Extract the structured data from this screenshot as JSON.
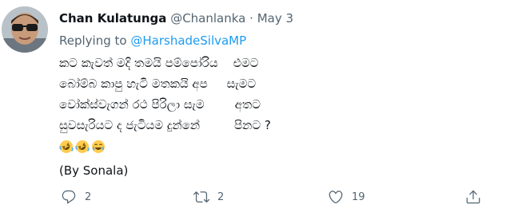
{
  "tweet": {
    "author_name": "Chan Kulatunga",
    "handle": "@Chanlanka",
    "separator": "·",
    "date": "May 3",
    "replying_prefix": "Replying to",
    "replying_to": "@HarshadeSilvaMP",
    "lines": [
      "කට කැවත් මදි තමයි පම්පෝරිය    එමට",
      "බෝම්බ කාපු හැටි මතකයි අප     සැමට",
      "වෝක්ස්වැගන් රථ පිරිලා සැම        අතට",
      "සුවසැරියට ද ජැටියම දුන්නේ         පිනට ?"
    ],
    "emojis": [
      "rolling-on-floor-laughing",
      "rolling-on-floor-laughing",
      "joy"
    ],
    "credit": "(By Sonala)",
    "actions": {
      "reply_count": "2",
      "retweet_count": "2",
      "like_count": "19"
    }
  }
}
